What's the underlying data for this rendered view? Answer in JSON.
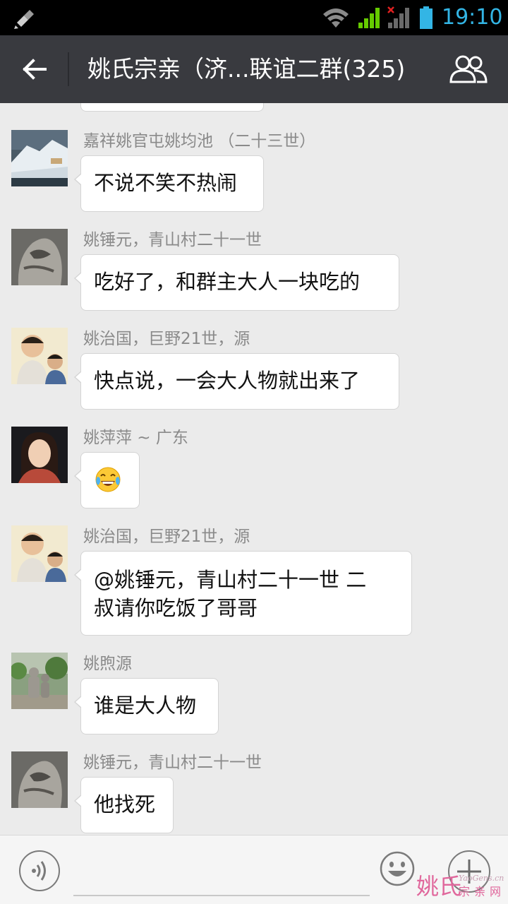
{
  "status_bar": {
    "time": "19:10",
    "icons": [
      "cleaner-icon",
      "wifi-icon",
      "signal-icon",
      "signal-no-service-icon",
      "battery-icon"
    ],
    "accent_color": "#33b5e5"
  },
  "header": {
    "back_icon": "arrow-left-icon",
    "title": "姚氏宗亲（济...联谊二群(325)",
    "members_icon": "group-members-icon",
    "background_color": "#393a3f"
  },
  "messages": [
    {
      "sender": "嘉祥姚官屯姚均池 （二十三世）",
      "text": "不说不笑不热闹",
      "avatar": "snow-landscape-avatar"
    },
    {
      "sender": "姚锤元，青山村二十一世",
      "text": "吃好了，和群主大人一块吃的",
      "avatar": "stone-carving-avatar"
    },
    {
      "sender": "姚治国，巨野21世，源",
      "text": "快点说，一会大人物就出来了",
      "avatar": "children-photo-avatar"
    },
    {
      "sender": "姚萍萍 ~ 广东",
      "text": "",
      "emoji": "tears-of-joy-emoji",
      "avatar": "woman-portrait-avatar"
    },
    {
      "sender": "姚治国，巨野21世，源",
      "text_lines": [
        "@姚锤元，青山村二十一世 二",
        "叔请你吃饭了哥哥"
      ],
      "avatar": "children-photo-avatar"
    },
    {
      "sender": "姚煦源",
      "text": "谁是大人物",
      "avatar": "garden-statue-avatar"
    },
    {
      "sender": "姚锤元，青山村二十一世",
      "text": "他找死",
      "avatar": "stone-carving-avatar"
    }
  ],
  "input_bar": {
    "voice_icon": "voice-input-icon",
    "emoji_icon": "smiley-face-icon",
    "plus_icon": "plus-more-icon"
  },
  "watermark": {
    "main": "姚氏",
    "sub": "宗亲网",
    "url": "YaoGens.cn"
  }
}
